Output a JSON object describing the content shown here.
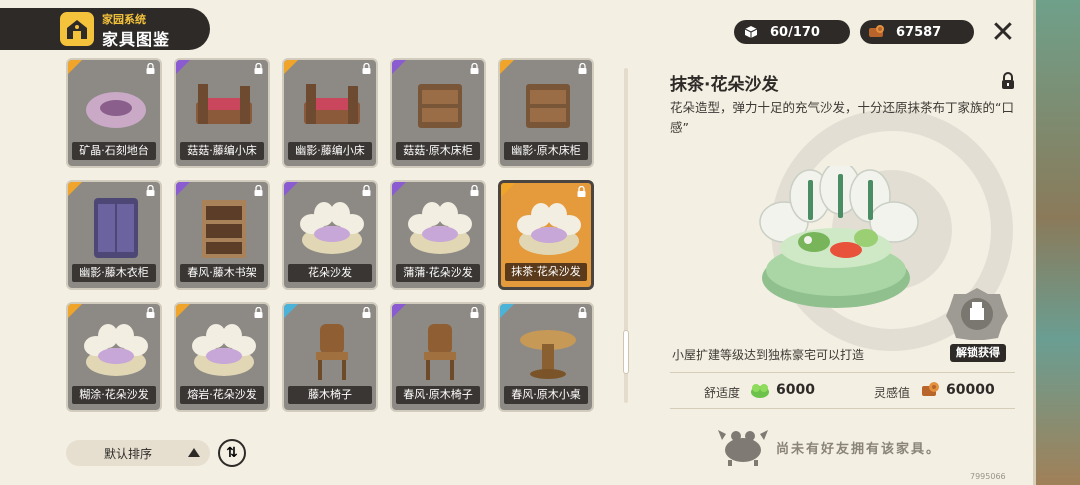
{
  "header": {
    "subtitle": "家园系统",
    "title": "家具图鉴",
    "icon": "house-icon"
  },
  "resources": {
    "capacity": {
      "icon": "cube-icon",
      "value": "60/170"
    },
    "currency": {
      "icon": "wood-coin-icon",
      "value": "67587"
    }
  },
  "close": {
    "icon": "close-icon",
    "glyph": "✕"
  },
  "grid": {
    "items": [
      {
        "label": "矿晶·石刻地台",
        "rarity": "orange",
        "icon": "rug-icon"
      },
      {
        "label": "菇菇·藤编小床",
        "rarity": "purple",
        "icon": "bed-icon"
      },
      {
        "label": "幽影·藤编小床",
        "rarity": "orange",
        "icon": "bed-icon"
      },
      {
        "label": "菇菇·原木床柜",
        "rarity": "purple",
        "icon": "nightstand-icon"
      },
      {
        "label": "幽影·原木床柜",
        "rarity": "orange",
        "icon": "nightstand-icon"
      },
      {
        "label": "幽影·藤木衣柜",
        "rarity": "orange",
        "icon": "wardrobe-icon"
      },
      {
        "label": "春风·藤木书架",
        "rarity": "purple",
        "icon": "bookshelf-icon"
      },
      {
        "label": "花朵沙发",
        "rarity": "purple",
        "icon": "flower-sofa-icon"
      },
      {
        "label": "蒲蒲·花朵沙发",
        "rarity": "purple",
        "icon": "flower-sofa-icon"
      },
      {
        "label": "抹茶·花朵沙发",
        "rarity": "orange",
        "icon": "flower-sofa-icon",
        "selected": true
      },
      {
        "label": "糊涂·花朵沙发",
        "rarity": "orange",
        "icon": "flower-sofa-icon"
      },
      {
        "label": "熔岩·花朵沙发",
        "rarity": "orange",
        "icon": "flower-sofa-icon"
      },
      {
        "label": "藤木椅子",
        "rarity": "blue",
        "icon": "chair-icon"
      },
      {
        "label": "春风·原木椅子",
        "rarity": "purple",
        "icon": "chair-icon"
      },
      {
        "label": "春风·原木小桌",
        "rarity": "blue",
        "icon": "table-icon"
      }
    ]
  },
  "sort": {
    "label": "默认排序",
    "order_icon": "sort-order-icon",
    "order_glyph": "⇅"
  },
  "detail": {
    "title": "抹茶·花朵沙发",
    "description": "花朵造型，弹力十足的充气沙发，十分还原抹茶布丁家族的“口感”",
    "requirement": "小屋扩建等级达到独栋豪宅可以打造",
    "unlock_button": "解锁获得",
    "stats": [
      {
        "label": "舒适度",
        "icon": "comfort-icon",
        "value": "6000"
      },
      {
        "label": "灵感值",
        "icon": "inspiration-icon",
        "value": "60000"
      }
    ],
    "no_friend_text": "尚未有好友拥有该家具。"
  },
  "uid": "7995066",
  "colors": {
    "orange": "#f0a52a",
    "purple": "#8b5bd1",
    "blue": "#4bb3d8",
    "selected": "#e59a3c",
    "dark": "#2d2a28"
  }
}
